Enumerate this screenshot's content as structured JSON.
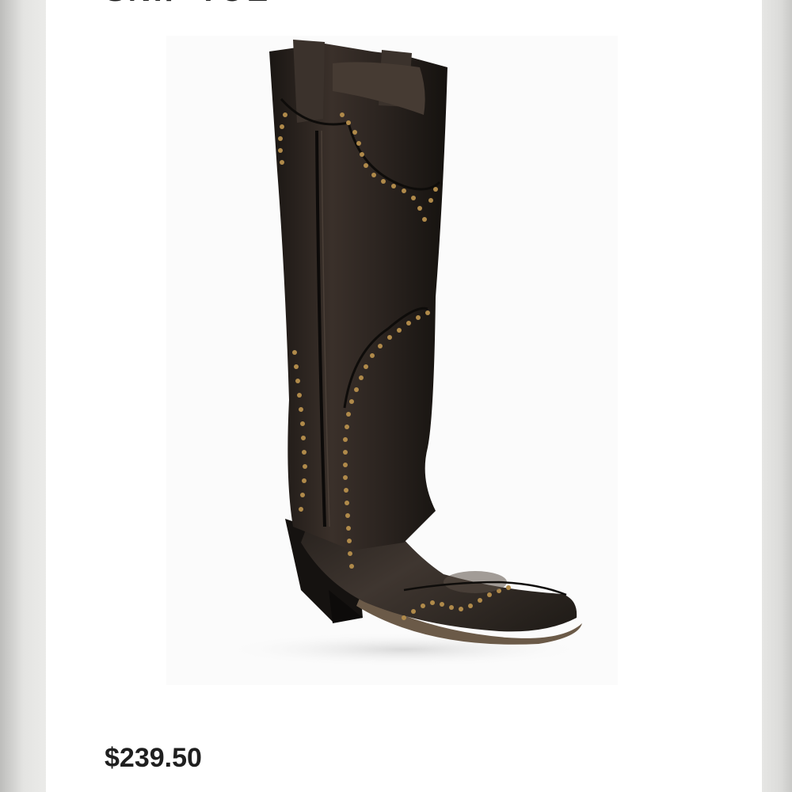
{
  "product": {
    "title_partial": "SNIP TOE",
    "image_alt": "Distressed black leather western boot with brass studs",
    "price": "$239.50"
  },
  "colors": {
    "leather": "#2a2420",
    "leather_dark": "#141110",
    "stud": "#b08a4a",
    "sole": "#6b5a48",
    "background": "#ffffff"
  }
}
